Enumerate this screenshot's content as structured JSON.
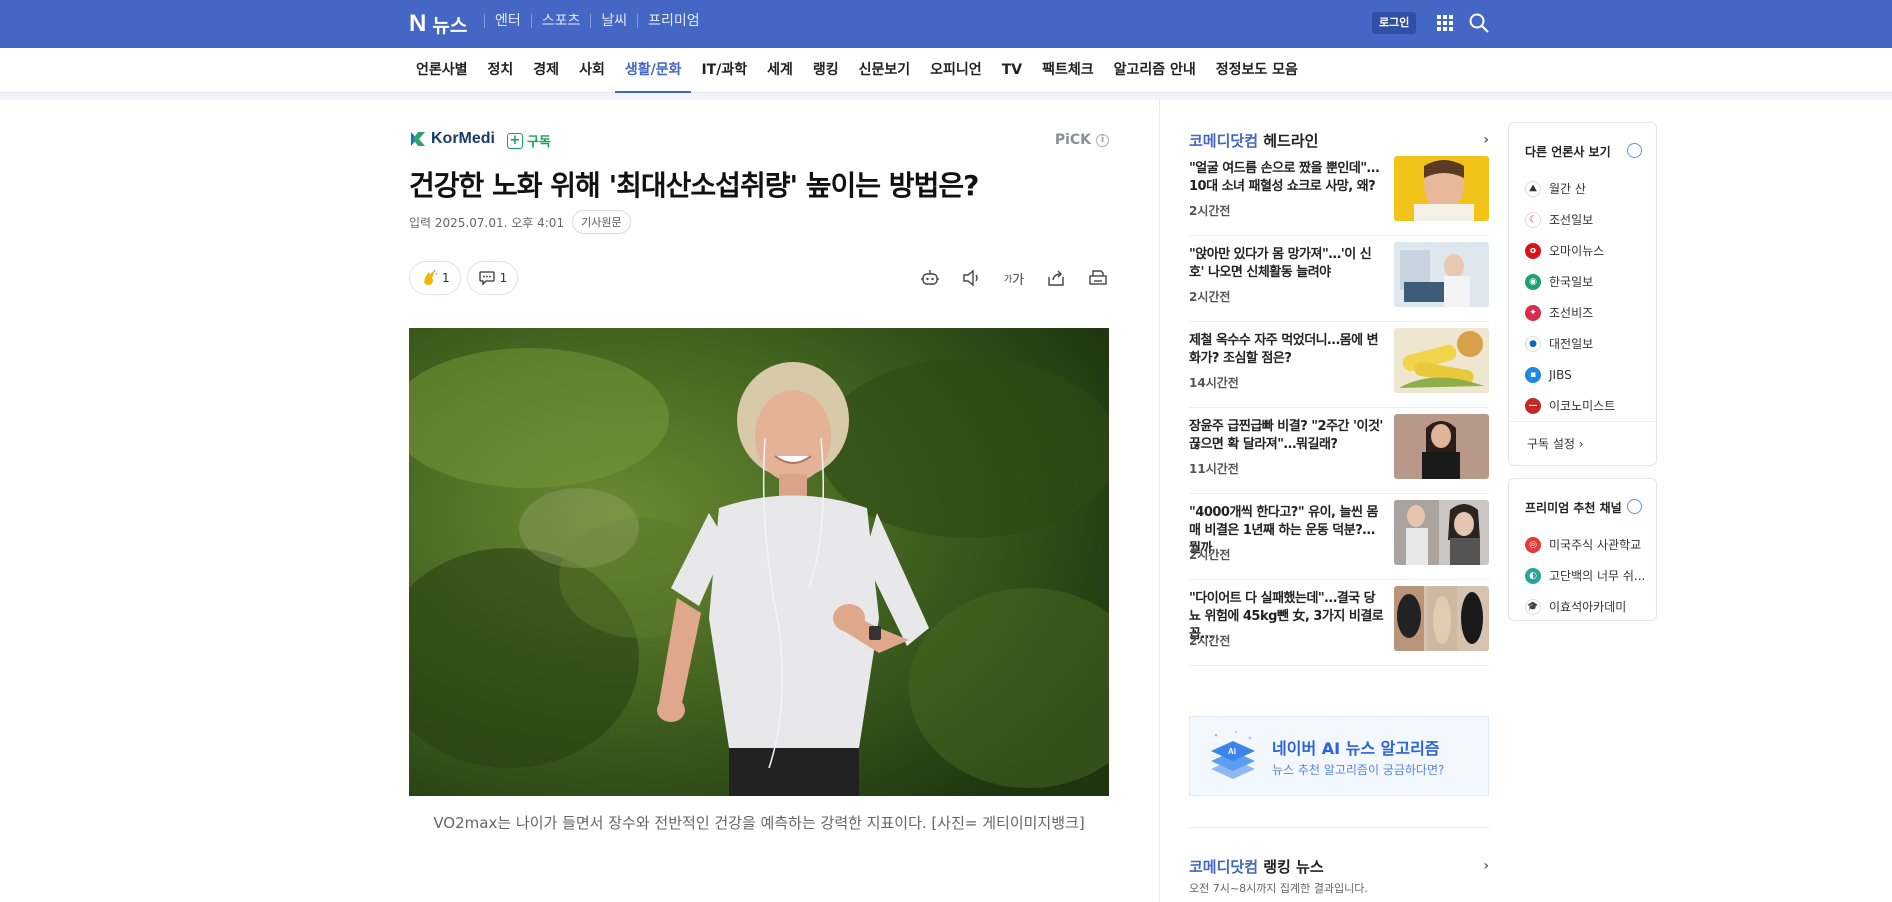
{
  "header": {
    "logo": "N",
    "service_name": "뉴스",
    "services": [
      "엔터",
      "스포츠",
      "날씨",
      "프리미엄"
    ],
    "login_label": "로그인",
    "brand_color": "#4466c4"
  },
  "nav": {
    "items": [
      "언론사별",
      "정치",
      "경제",
      "사회",
      "생활/문화",
      "IT/과학",
      "세계",
      "랭킹",
      "신문보기",
      "오피니언",
      "TV",
      "팩트체크",
      "알고리즘 안내",
      "정정보도 모음"
    ],
    "active": "생활/문화"
  },
  "article": {
    "press_logo": "KorMedi",
    "subscribe_label": "구독",
    "pick_label": "PiCK",
    "title": "건강한 노화 위해 '최대산소섭취량' 높이는 방법은?",
    "date": "입력 2025.07.01. 오후 4:01",
    "original_label": "기사원문",
    "like_count": "1",
    "comment_count": "1",
    "font_size_label": "가",
    "caption": "VO2max는 나이가 들면서 장수와 전반적인 건강을 예측하는 강력한 지표이다. [사진= 게티이미지뱅크]"
  },
  "headlines": {
    "press": "코메디닷컴",
    "title_suffix": " 헤드라인",
    "items": [
      {
        "title": "\"얼굴 여드름 손으로 짰을 뿐인데\"…10대 소녀 패혈성 쇼크로 사망, 왜?",
        "time": "2시간전"
      },
      {
        "title": "\"앉아만 있다가 몸 망가져\"…'이 신호' 나오면 신체활동 늘려야",
        "time": "2시간전"
      },
      {
        "title": "제철 옥수수 자주 먹었더니…몸에 변화가? 조심할 점은?",
        "time": "14시간전"
      },
      {
        "title": "장윤주 급찐급빠 비결? \"2주간 '이것' 끊으면 확 달라져\"…뭐길래?",
        "time": "11시간전"
      },
      {
        "title": "\"4000개씩 한다고?\" 유이, 늘씬 몸매 비결은 1년째 하는 운동 덕분?…뭘까",
        "time": "2시간전"
      },
      {
        "title": "\"다이어트 다 실패했는데\"…결국 당뇨 위험에 45kg뺀 女, 3가지 비결로 꼽…",
        "time": "2시간전"
      }
    ]
  },
  "ai_banner": {
    "title": "네이버 AI 뉴스 알고리즘",
    "subtitle": "뉴스 추천 알고리즘이 궁금하다면?",
    "badge": "AI"
  },
  "ranking": {
    "press": "코메디닷컴",
    "title_suffix": " 랭킹 뉴스",
    "subtitle": "오전 7시~8시까지 집계한 결과입니다."
  },
  "other_press": {
    "title": "다른 언론사 보기",
    "items": [
      {
        "name": "월간 산",
        "color": "#ffffff"
      },
      {
        "name": "조선일보",
        "color": "#ffffff"
      },
      {
        "name": "오마이뉴스",
        "color": "#d7141a"
      },
      {
        "name": "한국일보",
        "color": "#1aa36f"
      },
      {
        "name": "조선비즈",
        "color": "#d32f4a"
      },
      {
        "name": "대전일보",
        "color": "#ffffff"
      },
      {
        "name": "JIBS",
        "color": "#1e88e5"
      },
      {
        "name": "이코노미스트",
        "color": "#c62828"
      }
    ],
    "setting_label": "구독 설정"
  },
  "premium": {
    "title": "프리미엄 추천 채널",
    "items": [
      {
        "name": "미국주식 사관학교",
        "color": "#e53935"
      },
      {
        "name": "고단백의 너무 쉬...",
        "color": "#26a69a"
      },
      {
        "name": "이효석아카데미",
        "color": "#ffffff"
      }
    ]
  }
}
